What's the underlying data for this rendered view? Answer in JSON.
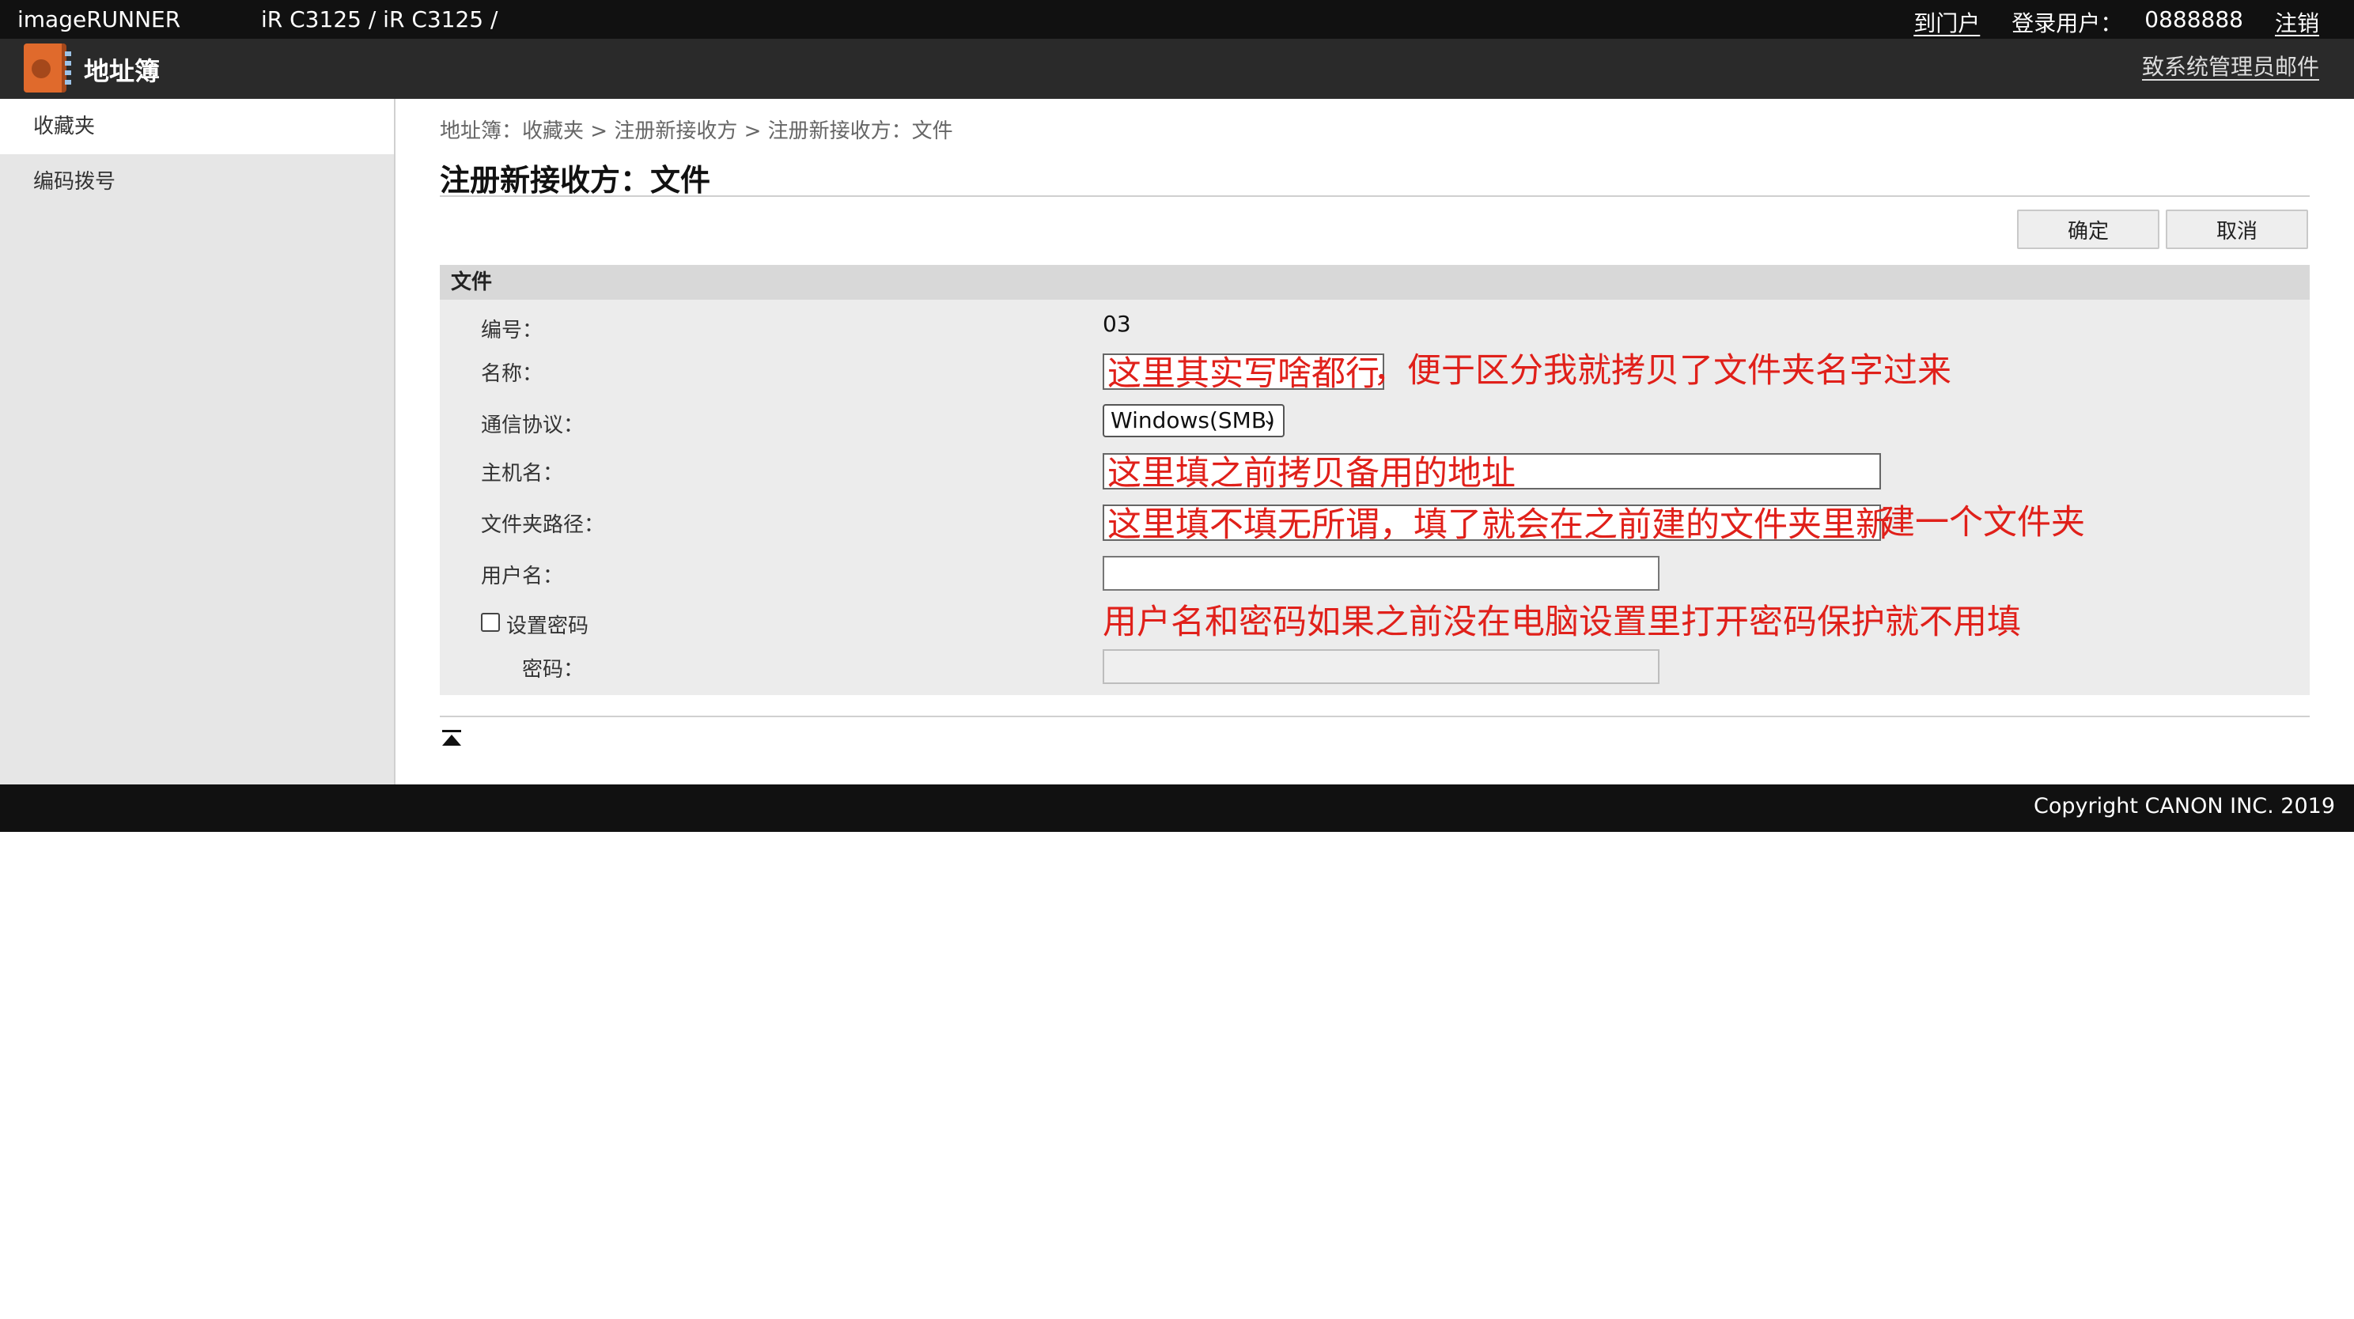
{
  "topbar": {
    "brand": "imageRUNNER",
    "model": "iR C3125 / iR C3125 /",
    "portal_link": "到门户",
    "login_user_label": "登录用户：",
    "login_user_value": "0888888",
    "logout_link": "注销"
  },
  "header": {
    "title": "地址簿",
    "mail_link": "致系统管理员邮件",
    "logo_icon": "address-book-icon"
  },
  "sidebar": {
    "items": [
      {
        "label": "收藏夹",
        "active": true
      },
      {
        "label": "编码拨号",
        "active": false
      }
    ]
  },
  "main": {
    "breadcrumb": "地址簿：收藏夹 > 注册新接收方 > 注册新接收方：文件",
    "page_title": "注册新接收方：文件",
    "ok_button": "确定",
    "cancel_button": "取消",
    "section_title": "文件",
    "fields": {
      "number_label": "编号：",
      "number_value": "03",
      "name_label": "名称：",
      "name_value": "这里其实写啥都行",
      "name_note": "，便于区分我就拷贝了文件夹名字过来",
      "protocol_label": "通信协议：",
      "protocol_value": "Windows(SMB)",
      "host_label": "主机名：",
      "host_value": "这里填之前拷贝备用的地址",
      "path_label": "文件夹路径：",
      "path_value": "这里填不填无所谓，填了就会在之前建的文件夹里新",
      "path_note": "建一个文件夹",
      "username_label": "用户名：",
      "username_value": "",
      "set_password_label": "设置密码",
      "set_password_checked": false,
      "password_note": "用户名和密码如果之前没在电脑设置里打开密码保护就不用填",
      "password_label": "密码：",
      "password_value": ""
    },
    "back_to_top_icon": "back-to-top-icon"
  },
  "footer": {
    "copyright": "Copyright CANON INC. 2019"
  },
  "colors": {
    "annotation": "#e0201a",
    "topbar": "#111111",
    "headerbar": "#2a2a2a",
    "logo": "#e06a2c"
  }
}
